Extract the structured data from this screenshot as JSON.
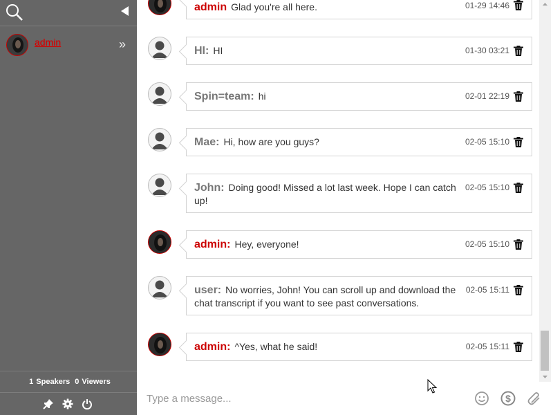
{
  "sidebar": {
    "username": "admin",
    "speakers_count": "1",
    "speakers_label": "Speakers",
    "viewers_count": "0",
    "viewers_label": "Viewers"
  },
  "messages": [
    {
      "sender": "admin",
      "text": "Glad you're all here.",
      "time": "01-29 14:46",
      "is_admin": true
    },
    {
      "sender": "HI:",
      "text": "HI",
      "time": "01-30 03:21",
      "is_admin": false
    },
    {
      "sender": "Spin=team:",
      "text": "hi",
      "time": "02-01 22:19",
      "is_admin": false
    },
    {
      "sender": "Mae:",
      "text": "Hi, how are you guys?",
      "time": "02-05 15:10",
      "is_admin": false
    },
    {
      "sender": "John:",
      "text": "Doing good! Missed a lot last week. Hope I can catch up!",
      "time": "02-05 15:10",
      "is_admin": false
    },
    {
      "sender": "admin:",
      "text": "Hey, everyone!",
      "time": "02-05 15:10",
      "is_admin": true
    },
    {
      "sender": "user:",
      "text": "No worries, John! You can scroll up and download the chat transcript if you want to see past conversations.",
      "time": "02-05 15:11",
      "is_admin": false
    },
    {
      "sender": "admin:",
      "text": "^Yes, what he said!",
      "time": "02-05 15:11",
      "is_admin": true
    }
  ],
  "composer": {
    "placeholder": "Type a message..."
  },
  "colors": {
    "sidebar_bg": "#666666",
    "admin_red": "#cc0000",
    "sender_gray": "#777777"
  },
  "icons": [
    "search-icon",
    "collapse-arrow-icon",
    "expand-chevrons-icon",
    "pin-icon",
    "gear-icon",
    "power-icon",
    "trash-icon",
    "emoji-icon",
    "dollar-icon",
    "paperclip-icon"
  ]
}
